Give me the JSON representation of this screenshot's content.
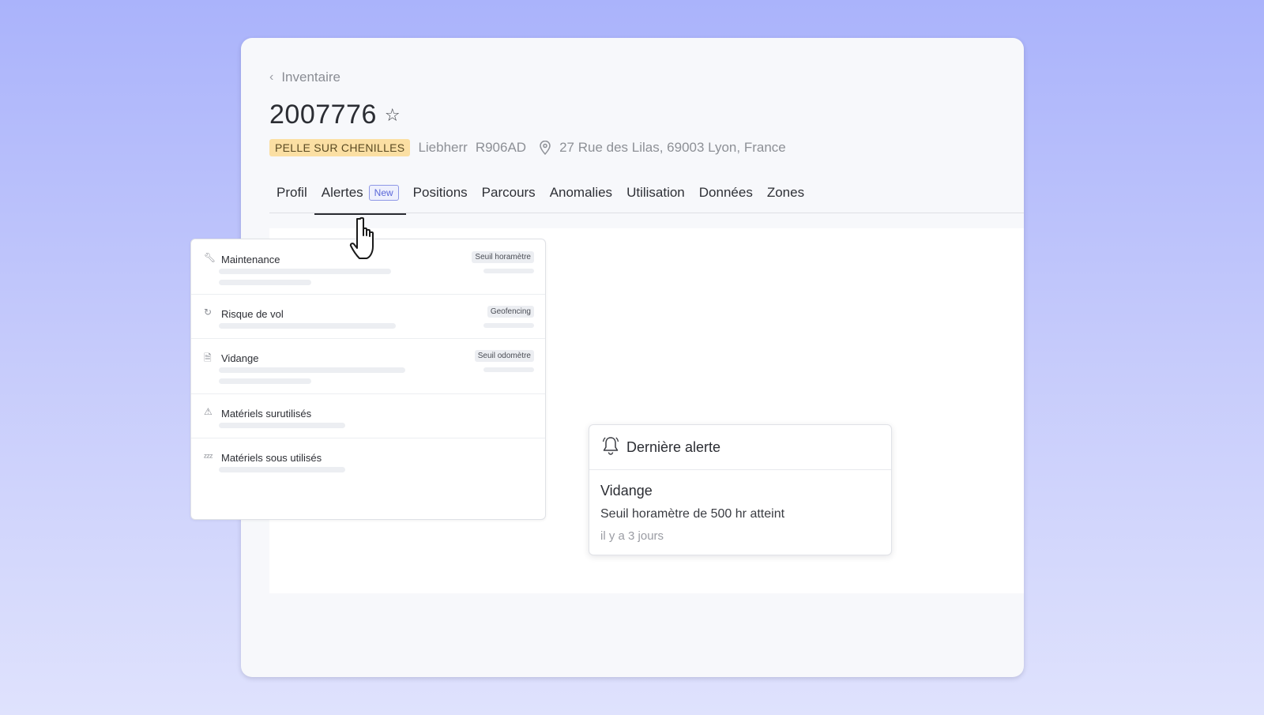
{
  "breadcrumb": {
    "label": "Inventaire"
  },
  "asset": {
    "id": "2007776",
    "category": "PELLE SUR CHENILLES",
    "brand": "Liebherr",
    "model": "R906AD",
    "address": "27 Rue des Lilas, 69003 Lyon, France"
  },
  "tabs": [
    {
      "label": "Profil"
    },
    {
      "label": "Alertes",
      "badge": "New"
    },
    {
      "label": "Positions"
    },
    {
      "label": "Parcours"
    },
    {
      "label": "Anomalies"
    },
    {
      "label": "Utilisation"
    },
    {
      "label": "Données"
    },
    {
      "label": "Zones"
    }
  ],
  "alert_types": [
    {
      "title": "Maintenance",
      "tag": "Seuil horamètre",
      "icon": "wrench-icon"
    },
    {
      "title": "Risque de vol",
      "tag": "Geofencing",
      "icon": "route-icon"
    },
    {
      "title": "Vidange",
      "tag": "Seuil odomètre",
      "icon": "file-icon"
    },
    {
      "title": "Matériels surutilisés",
      "tag": "",
      "icon": "warning-icon"
    },
    {
      "title": "Matériels sous utilisés",
      "tag": "",
      "icon": "sleep-icon"
    }
  ],
  "last_alert": {
    "header": "Dernière alerte",
    "title": "Vidange",
    "description": "Seuil horamètre de 500 hr atteint",
    "time": "il y a 3 jours"
  },
  "colors": {
    "background_top": "#aab3fb",
    "card": "#f7f8fb",
    "tag": "#fbdfa3",
    "badge": "#5a67d8"
  }
}
